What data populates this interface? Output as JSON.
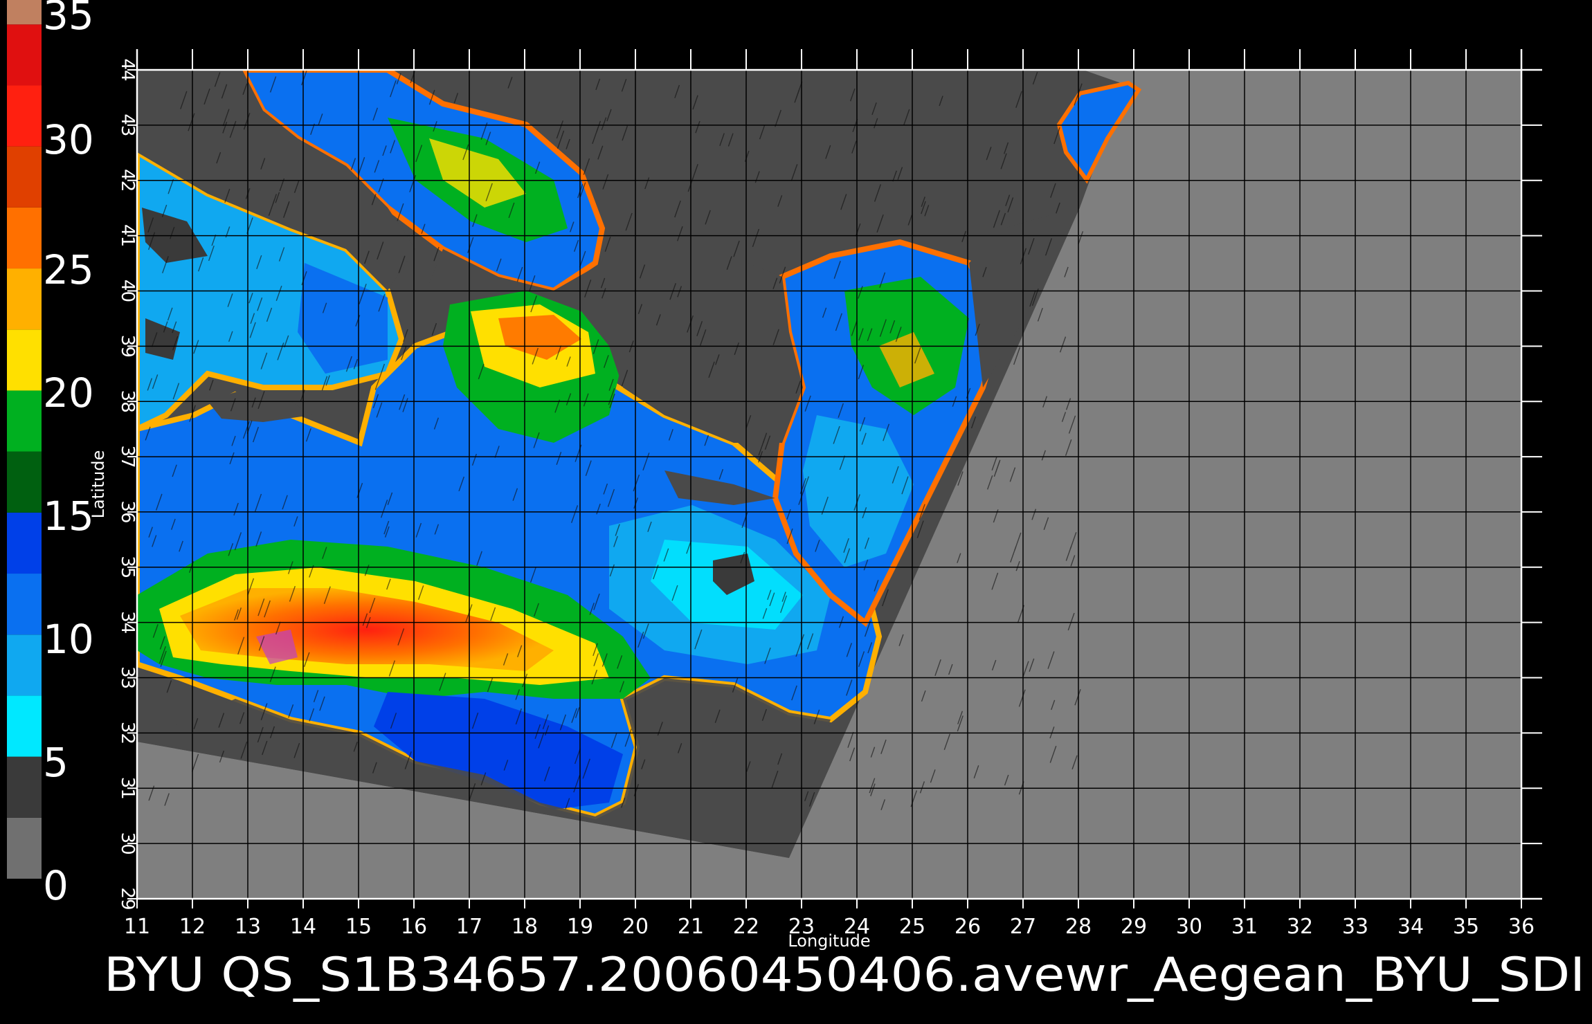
{
  "title": "BYU  QS_S1B34657.20060450406.avewr_Aegean_BYU_SDI",
  "colorbar": {
    "labels": [
      "0",
      "5",
      "10",
      "15",
      "20",
      "25",
      "30",
      "35"
    ],
    "segments": [
      {
        "from": 0,
        "to": 2.5,
        "color": "#707070"
      },
      {
        "from": 2.5,
        "to": 5,
        "color": "#3a3a3a"
      },
      {
        "from": 5,
        "to": 7.5,
        "color": "#00e8ff"
      },
      {
        "from": 7.5,
        "to": 10,
        "color": "#10a8f0"
      },
      {
        "from": 10,
        "to": 12.5,
        "color": "#0a70f0"
      },
      {
        "from": 12.5,
        "to": 15,
        "color": "#0040e8"
      },
      {
        "from": 15,
        "to": 17.5,
        "color": "#006010"
      },
      {
        "from": 17.5,
        "to": 20,
        "color": "#00b020"
      },
      {
        "from": 20,
        "to": 22.5,
        "color": "#ffe000"
      },
      {
        "from": 22.5,
        "to": 25,
        "color": "#ffb000"
      },
      {
        "from": 25,
        "to": 27.5,
        "color": "#ff7000"
      },
      {
        "from": 27.5,
        "to": 30,
        "color": "#e04000"
      },
      {
        "from": 30,
        "to": 32.5,
        "color": "#ff2010"
      },
      {
        "from": 32.5,
        "to": 35,
        "color": "#e01010"
      },
      {
        "from": 35,
        "to": 36,
        "color": "#c08060"
      }
    ]
  },
  "map": {
    "xlabel": "Longitude",
    "ylabel": "Latitude",
    "lon_ticks": [
      "11",
      "12",
      "13",
      "14",
      "15",
      "16",
      "17",
      "18",
      "19",
      "20",
      "21",
      "22",
      "23",
      "24",
      "25",
      "26",
      "27",
      "28",
      "29",
      "30",
      "31",
      "32",
      "33",
      "34",
      "35",
      "36"
    ],
    "lat_ticks": [
      "29",
      "30",
      "31",
      "32",
      "33",
      "34",
      "35",
      "36",
      "37",
      "38",
      "39",
      "40",
      "41",
      "42",
      "43",
      "44"
    ],
    "xlim": [
      11,
      36
    ],
    "ylim": [
      29,
      44
    ],
    "colors": {
      "nodata": "#7f7f7f",
      "land": "#4a4a4a",
      "grid": "#000000"
    }
  }
}
